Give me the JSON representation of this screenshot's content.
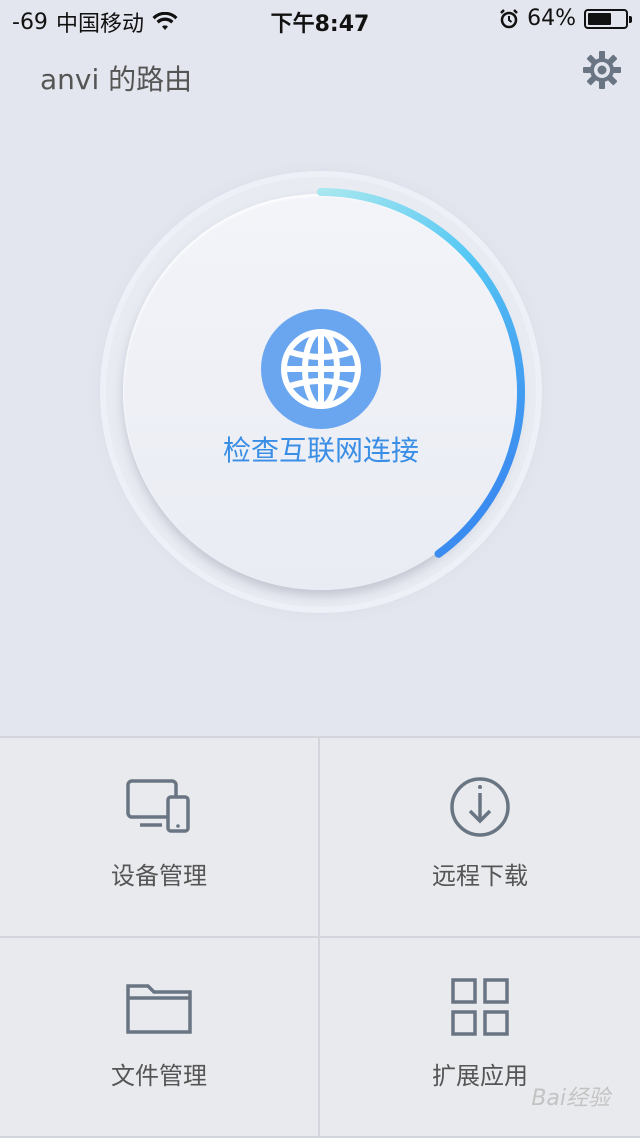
{
  "status_bar": {
    "signal": "-69",
    "carrier": "中国移动",
    "time": "下午8:47",
    "battery": "64%",
    "battery_level": 0.64
  },
  "header": {
    "title": "anvi 的路由"
  },
  "dial": {
    "label": "检查互联网连接",
    "progress": 0.4,
    "colors": {
      "arc_start": "#a8e7ef",
      "arc_end": "#3b8cf0",
      "globe": "#6aa6ef",
      "label": "#3a8ee6"
    }
  },
  "tiles": [
    {
      "label": "设备管理",
      "icon": "devices-icon"
    },
    {
      "label": "远程下载",
      "icon": "download-icon"
    },
    {
      "label": "文件管理",
      "icon": "folder-icon"
    },
    {
      "label": "扩展应用",
      "icon": "apps-grid-icon"
    }
  ],
  "watermark": "Bai经验"
}
